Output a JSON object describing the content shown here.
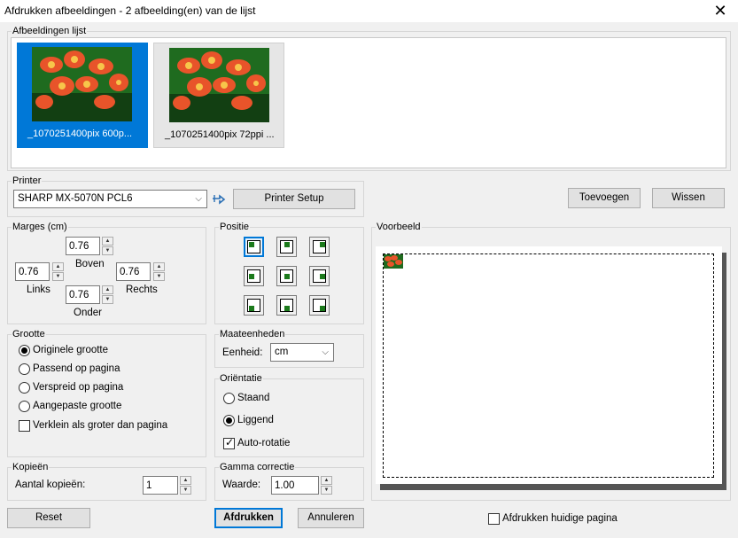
{
  "window": {
    "title": "Afdrukken afbeeldingen  -  2 afbeelding(en) van de lijst",
    "close_icon": "close-icon"
  },
  "images_list": {
    "legend": "Afbeeldingen lijst",
    "items": [
      {
        "caption": "_1070251400pix 600p...",
        "selected": true
      },
      {
        "caption": "_1070251400pix 72ppi ...",
        "selected": false
      }
    ]
  },
  "printer": {
    "legend": "Printer",
    "selected": "SHARP MX-5070N PCL6",
    "refresh_icon": "refresh-printers-icon",
    "setup_label": "Printer Setup"
  },
  "list_buttons": {
    "add": "Toevoegen",
    "clear": "Wissen"
  },
  "margins": {
    "legend": "Marges (cm)",
    "top": {
      "label": "Boven",
      "value": "0.76"
    },
    "left": {
      "label": "Links",
      "value": "0.76"
    },
    "right": {
      "label": "Rechts",
      "value": "0.76"
    },
    "bottom": {
      "label": "Onder",
      "value": "0.76"
    }
  },
  "position": {
    "legend": "Positie",
    "selected": "top-left"
  },
  "size": {
    "legend": "Grootte",
    "options": [
      "Originele grootte",
      "Passend op pagina",
      "Verspreid op pagina",
      "Aangepaste grootte"
    ],
    "selected_index": 0,
    "shrink_label": "Verklein als groter dan pagina",
    "shrink_checked": false
  },
  "units": {
    "legend": "Maateenheden",
    "label": "Eenheid:",
    "value": "cm"
  },
  "orientation": {
    "legend": "Oriëntatie",
    "portrait": "Staand",
    "landscape": "Liggend",
    "selected": "landscape",
    "auto_rotate_label": "Auto-rotatie",
    "auto_rotate_checked": true
  },
  "copies": {
    "legend": "Kopieën",
    "label": "Aantal kopieën:",
    "value": "1"
  },
  "gamma": {
    "legend": "Gamma correctie",
    "label": "Waarde:",
    "value": "1.00"
  },
  "preview": {
    "legend": "Voorbeeld"
  },
  "footer": {
    "reset": "Reset",
    "print": "Afdrukken",
    "cancel": "Annuleren",
    "print_current_label": "Afdrukken huidige pagina",
    "print_current_checked": false
  },
  "colors": {
    "accent": "#0078d7",
    "flower_orange": "#e8542a",
    "leaf_green": "#1f6b1f"
  }
}
